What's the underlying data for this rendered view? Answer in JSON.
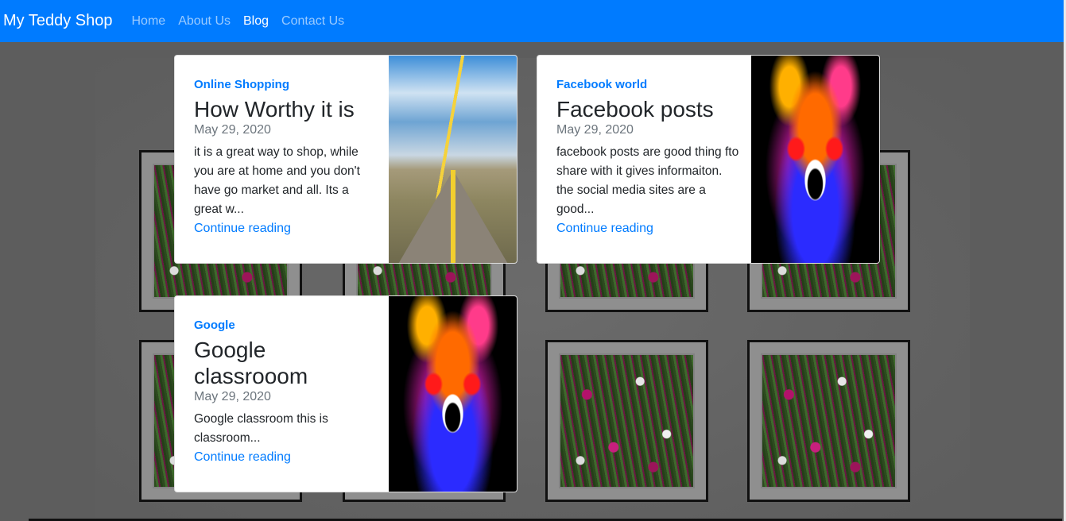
{
  "navbar": {
    "brand": "My Teddy Shop",
    "links": [
      {
        "label": "Home",
        "active": false
      },
      {
        "label": "About Us",
        "active": false
      },
      {
        "label": "Blog",
        "active": true
      },
      {
        "label": "Contact Us",
        "active": false
      }
    ]
  },
  "posts": [
    {
      "category": "Online Shopping",
      "title": "How Worthy it is",
      "date": "May 29, 2020",
      "excerpt": "it is a great way to shop, while you are at home and you don't have go market and all. Its a great w...",
      "read_more": "Continue reading",
      "thumbnail": "road-photo"
    },
    {
      "category": "Facebook world",
      "title": "Facebook posts",
      "date": "May 29, 2020",
      "excerpt": "facebook posts are good thing fto share with it gives informaiton. the social media sites are a good...",
      "read_more": "Continue reading",
      "thumbnail": "neon-wolf-photo"
    },
    {
      "category": "Google",
      "title": "Google classrooom",
      "date": "May 29, 2020",
      "excerpt": "Google classroom this is classroom...",
      "read_more": "Continue reading",
      "thumbnail": "neon-wolf-photo"
    }
  ],
  "colors": {
    "navbar": "#007bff",
    "accent": "#007bff",
    "background": "#5e5e5e",
    "card": "#ffffff"
  }
}
